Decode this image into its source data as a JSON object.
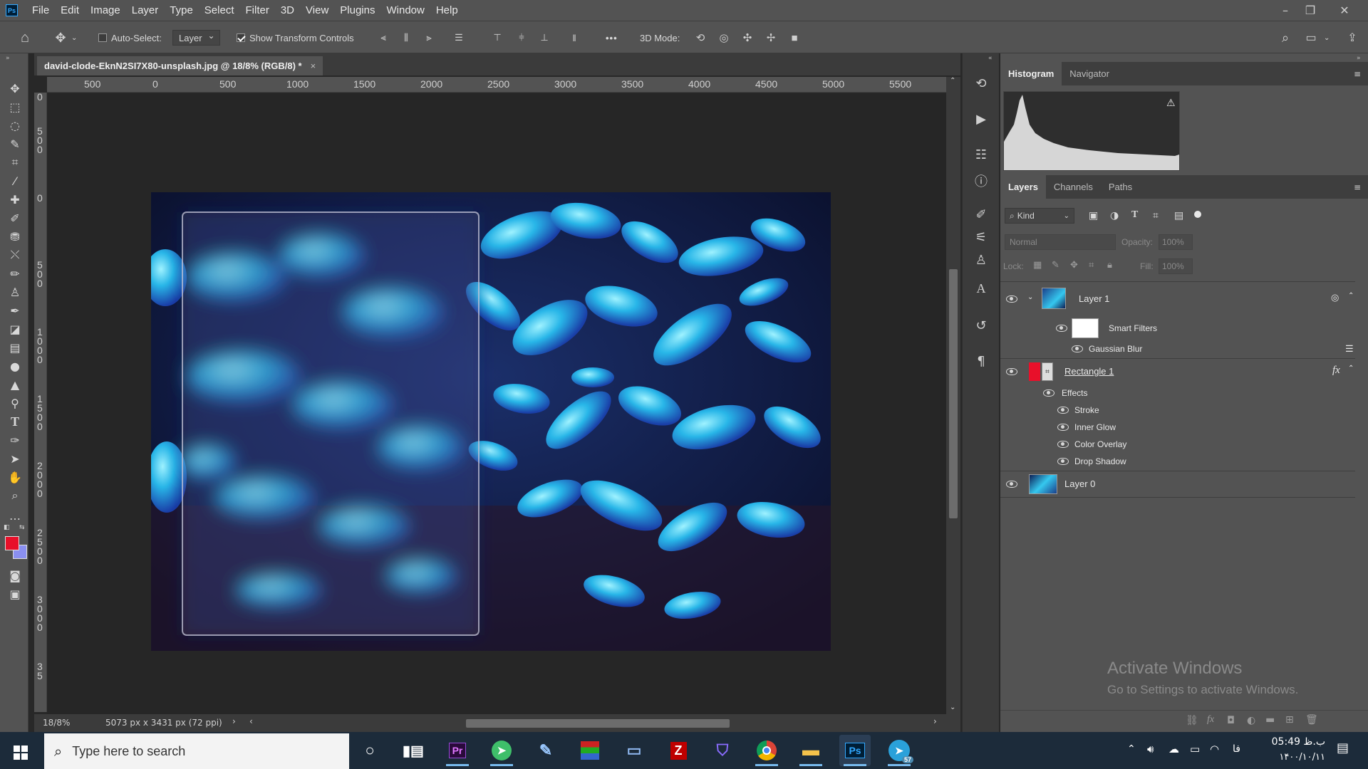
{
  "app": {
    "logo_text": "Ps"
  },
  "menu": [
    "File",
    "Edit",
    "Image",
    "Layer",
    "Type",
    "Select",
    "Filter",
    "3D",
    "View",
    "Plugins",
    "Window",
    "Help"
  ],
  "window_controls": [
    "minimize-icon",
    "restore-icon",
    "close-icon"
  ],
  "options_bar": {
    "auto_select_label": "Auto-Select:",
    "auto_select_checked": false,
    "auto_select_target": "Layer",
    "show_transform_label": "Show Transform Controls",
    "show_transform_checked": true,
    "more_label": "•••",
    "mode_3d_label": "3D Mode:"
  },
  "document": {
    "tab_title": "david-clode-EknN2SI7X80-unsplash.jpg @ 18/8% (RGB/8) *",
    "close_glyph": "×",
    "zoom": "18/8%",
    "doc_info": "5073 px x 3431 px (72 ppi)",
    "status_arrow": "›"
  },
  "ruler_h": [
    "500",
    "0",
    "500",
    "1000",
    "1500",
    "2000",
    "2500",
    "3000",
    "3500",
    "4000",
    "4500",
    "5000",
    "5500"
  ],
  "ruler_v": [
    "0",
    "5\n0\n0",
    "0",
    "5\n0\n0",
    "1\n0\n0\n0",
    "1\n5\n0\n0",
    "2\n0\n0\n0",
    "2\n5\n0\n0",
    "3\n0\n0\n0",
    "3\n5"
  ],
  "histogram_panel": {
    "tabs": [
      "Histogram",
      "Navigator"
    ],
    "active": "Histogram"
  },
  "layers_panel": {
    "tabs": [
      "Layers",
      "Channels",
      "Paths"
    ],
    "active": "Layers",
    "filter_label": "Kind",
    "blend_mode": "Normal",
    "opacity_label": "Opacity:",
    "opacity_value": "100%",
    "lock_label": "Lock:",
    "fill_label": "Fill:",
    "fill_value": "100%",
    "layers": [
      {
        "name": "Layer 1",
        "type": "smart-object",
        "visible": true
      },
      {
        "name": "Smart Filters",
        "type": "smart-filters",
        "visible": true
      },
      {
        "name": "Gaussian Blur",
        "type": "filter",
        "visible": true
      },
      {
        "name": "Rectangle 1",
        "type": "shape",
        "visible": true,
        "fx": "fx"
      },
      {
        "name": "Effects",
        "type": "effects",
        "visible": true
      },
      {
        "name": "Stroke",
        "type": "effect",
        "visible": true
      },
      {
        "name": "Inner Glow",
        "type": "effect",
        "visible": true
      },
      {
        "name": "Color Overlay",
        "type": "effect",
        "visible": true
      },
      {
        "name": "Drop Shadow",
        "type": "effect",
        "visible": true
      },
      {
        "name": "Layer 0",
        "type": "pixel",
        "visible": true
      }
    ]
  },
  "watermark": {
    "title": "Activate Windows",
    "subtitle": "Go to Settings to activate Windows."
  },
  "taskbar": {
    "search_placeholder": "Type here to search",
    "clock_time": "05:49 ب.ظ",
    "clock_date": "۱۴۰۰/۱۰/۱۱",
    "lang": "فا",
    "telegram_badge": "57",
    "apps": [
      "cortana-icon",
      "task-view-icon",
      "premiere-icon",
      "vpn-icon",
      "paint-icon",
      "winrar-icon",
      "explorer-icon",
      "filezilla-icon",
      "shield-vpn-icon",
      "chrome-icon",
      "folder-icon",
      "photoshop-icon",
      "telegram-icon"
    ]
  },
  "colors": {
    "foreground": "#e8102a",
    "background": "#8a8ff0",
    "accent": "#31a8ff"
  }
}
